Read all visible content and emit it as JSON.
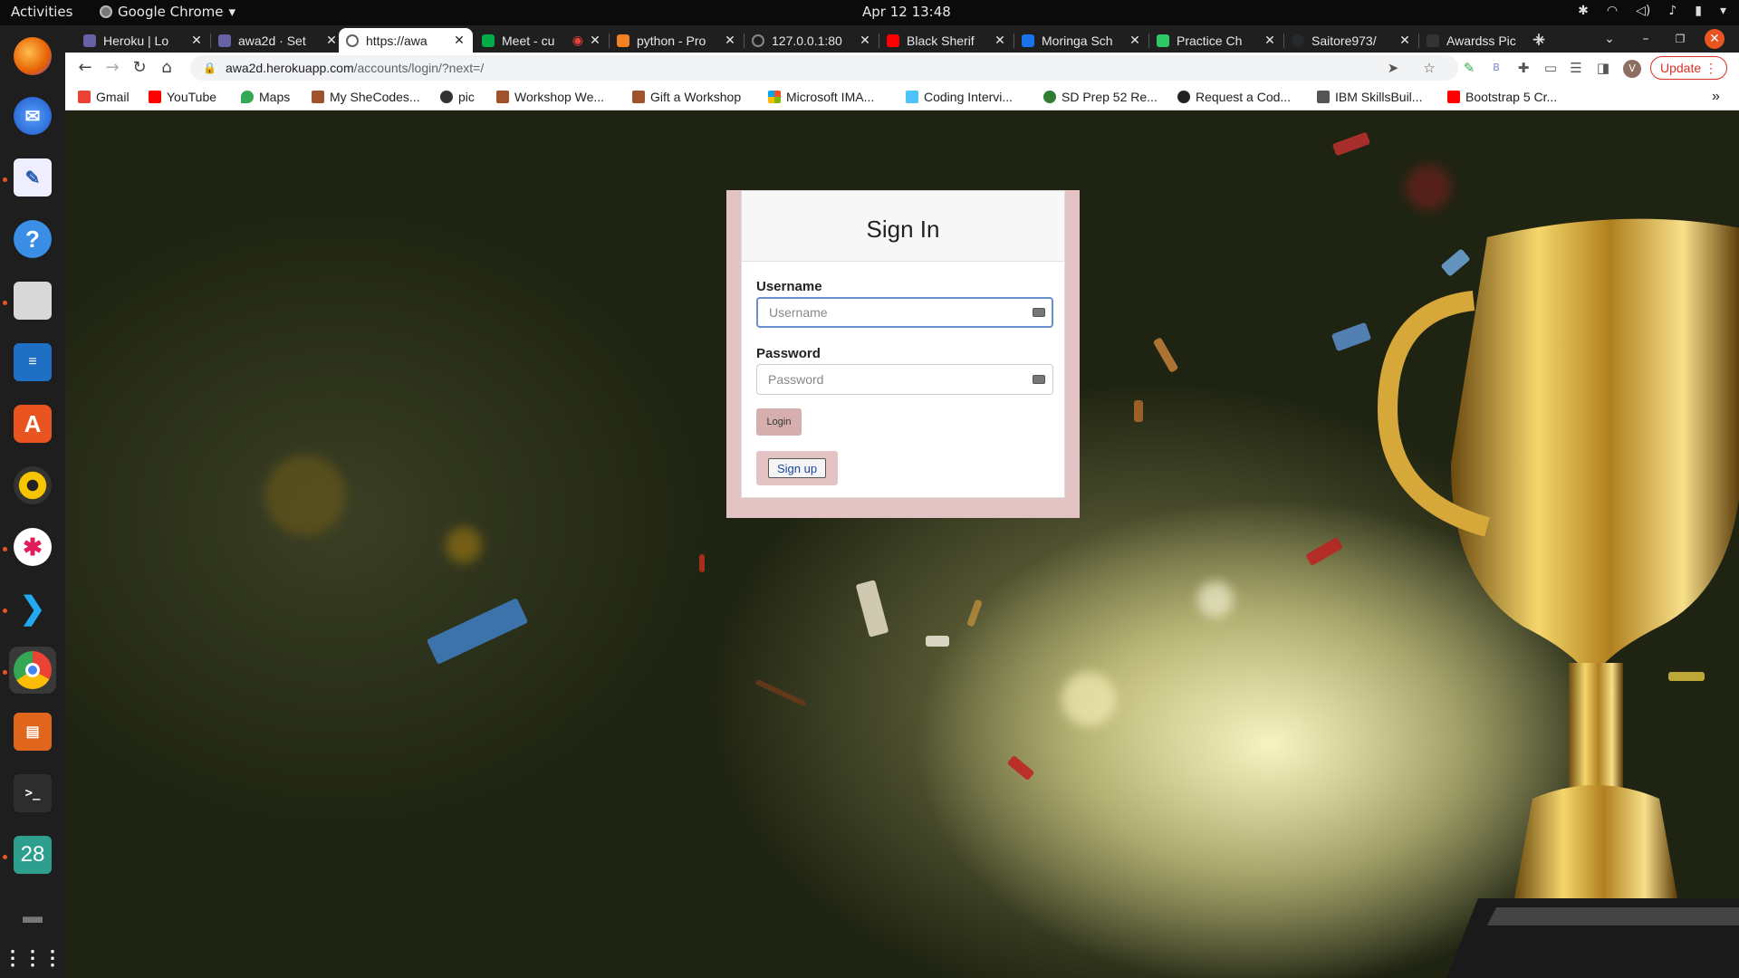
{
  "system": {
    "activities": "Activities",
    "app_name": "Google Chrome",
    "clock": "Apr 12  13:48"
  },
  "tabs": [
    {
      "title": "Heroku | Lo",
      "favicon_color": "#6762a6"
    },
    {
      "title": "awa2d · Set",
      "favicon_color": "#6762a6"
    },
    {
      "title": "https://awa",
      "favicon_color": "#5f6368"
    },
    {
      "title": "Meet - cu",
      "favicon_color": "#00ac47"
    },
    {
      "title": "python - Pro",
      "favicon_color": "#f48024"
    },
    {
      "title": "127.0.0.1:80",
      "favicon_color": "#5f6368"
    },
    {
      "title": "Black Sherif",
      "favicon_color": "#ff0000"
    },
    {
      "title": "Moringa Sch",
      "favicon_color": "#1a73e8"
    },
    {
      "title": "Practice Ch",
      "favicon_color": "#2ec866"
    },
    {
      "title": "Saitore973/",
      "favicon_color": "#24292e"
    },
    {
      "title": "Awardss Pic",
      "favicon_color": "#333333"
    }
  ],
  "address_bar": {
    "host": "awa2d.herokuapp.com",
    "path": "/accounts/login/?next=/"
  },
  "toolbar": {
    "update_label": "Update",
    "avatar_letter": "V"
  },
  "bookmarks": [
    {
      "label": "Gmail",
      "icon_color": "#ea4335"
    },
    {
      "label": "YouTube",
      "icon_color": "#ff0000"
    },
    {
      "label": "Maps",
      "icon_color": "#34a853"
    },
    {
      "label": "My SheCodes...",
      "icon_color": "#a0522d"
    },
    {
      "label": "pic",
      "icon_color": "#333333"
    },
    {
      "label": "Workshop We...",
      "icon_color": "#a0522d"
    },
    {
      "label": "Gift a Workshop",
      "icon_color": "#a0522d"
    },
    {
      "label": "Microsoft IMA...",
      "icon_color": "#f25022"
    },
    {
      "label": "Coding Intervi...",
      "icon_color": "#4fc3f7"
    },
    {
      "label": "SD Prep 52 Re...",
      "icon_color": "#2e7d32"
    },
    {
      "label": "Request a Cod...",
      "icon_color": "#222222"
    },
    {
      "label": "IBM SkillsBuil...",
      "icon_color": "#555555"
    },
    {
      "label": "Bootstrap 5 Cr...",
      "icon_color": "#ff0000"
    }
  ],
  "login": {
    "title": "Sign In",
    "username_label": "Username",
    "username_placeholder": "Username",
    "password_label": "Password",
    "password_placeholder": "Password",
    "login_button": "Login",
    "signup_button": "Sign up"
  },
  "dock": {
    "calendar_day": "28"
  }
}
